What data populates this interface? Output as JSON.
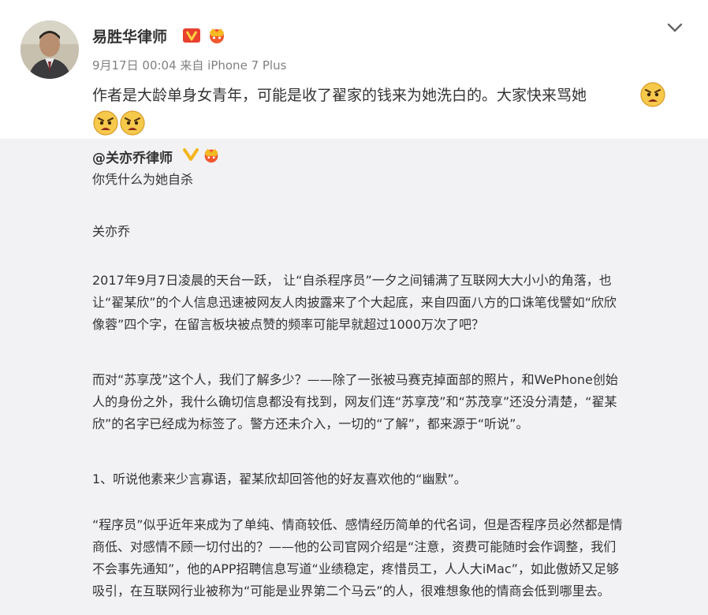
{
  "post": {
    "author": "易胜华律师",
    "meta": "9月17日 00:04 来自 iPhone 7 Plus",
    "text": "作者是大龄单身女青年，可能是收了翟家的钱来为她洗白的。大家快来骂她",
    "emoji": "angry-face-icon"
  },
  "repost": {
    "author": "@关亦乔律师",
    "title": "你凭什么为她自杀",
    "byline": "关亦乔",
    "paragraphs": [
      {
        "lines": [
          "2017年9月7日凌晨的天台一跃， 让“自杀程序员”一夕之间铺满了互联网大大小小的角落，也",
          "让“翟某欣”的个人信息迅速被网友人肉披露来了个大起底，来自四面八方的口诛笔伐譬如“欣欣",
          "像蓉”四个字，在留言板块被点赞的频率可能早就超过1000万次了吧？"
        ]
      },
      {
        "lines": [
          "而对“苏享茂”这个人，我们了解多少？——除了一张被马赛克掉面部的照片，和WePhone创始",
          "人的身份之外，我什么确切信息都没有找到，网友们连“苏享茂”和“苏茂享”还没分清楚，“翟某",
          "欣”的名字已经成为标签了。警方还未介入，一切的“了解”，都来源于“听说”。"
        ]
      },
      {
        "lines": [
          "1、听说他素来少言寡语，翟某欣却回答他的好友喜欢他的“幽默”。"
        ]
      },
      {
        "lines": [
          "“程序员”似乎近年来成为了单纯、情商较低、感情经历简单的代名词，但是否程序员必然都是情",
          "商低、对感情不顾一切付出的？——他的公司官网介绍是“注意，资费可能随时会作调整，我们",
          "不会事先通知”，他的APP招聘信息写道“业绩稳定，疼惜员工，人人大iMac”，如此傲娇又足够",
          "吸引，在互联网行业被称为“可能是业界第二个马云”的人，很难想象他的情商会低到哪里去。"
        ]
      }
    ]
  },
  "colors": {
    "background": "#ffffff",
    "repost_background": "#f2f2f5",
    "text": "#333333",
    "meta": "#808080",
    "verified_red": "#e9412f",
    "verified_yellow": "#f4b51f"
  }
}
